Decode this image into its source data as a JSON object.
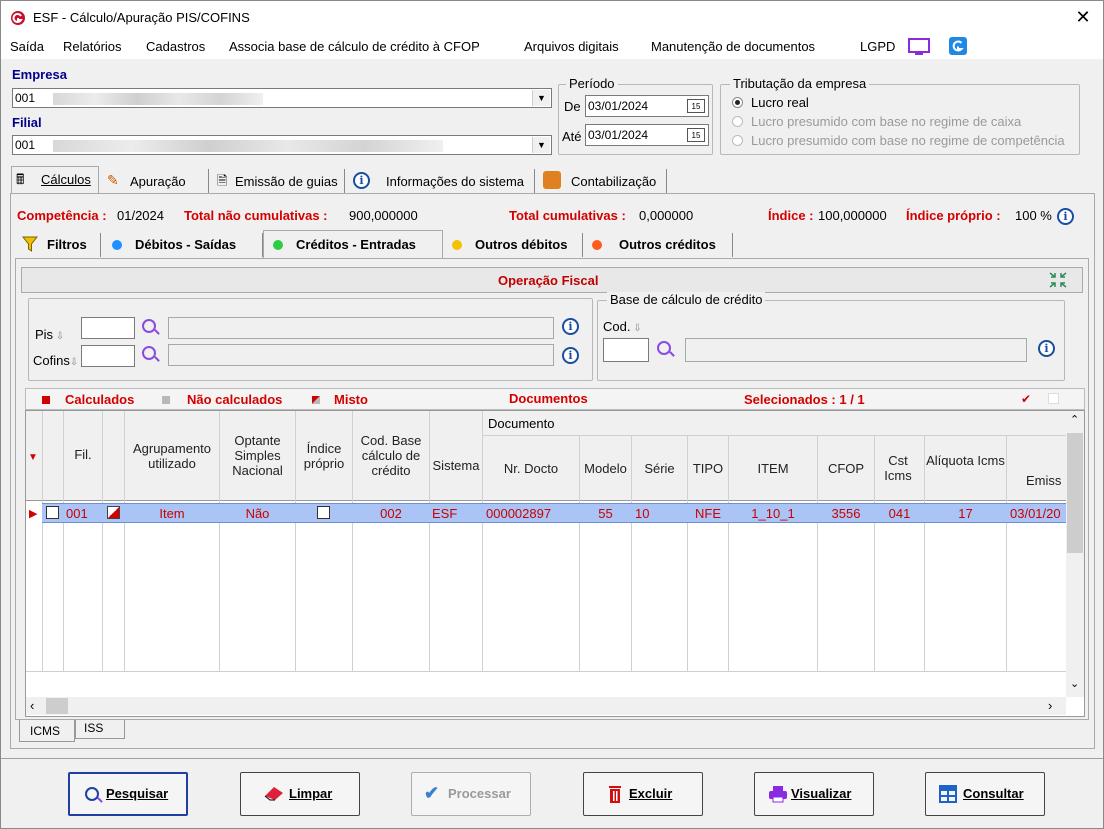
{
  "window": {
    "title": "ESF - Cálculo/Apuração PIS/COFINS",
    "close_glyph": "✕"
  },
  "menu": {
    "items": [
      "Saída",
      "Relatórios",
      "Cadastros",
      "Associa base de cálculo de crédito à CFOP",
      "Arquivos digitais",
      "Manutenção de documentos",
      "LGPD"
    ]
  },
  "empresa": {
    "label": "Empresa",
    "value": "001"
  },
  "filial": {
    "label": "Filial",
    "value": "001"
  },
  "periodo": {
    "legend": "Período",
    "de_label": "De",
    "de_value": "03/01/2024",
    "ate_label": "Até",
    "ate_value": "03/01/2024",
    "cal_glyph": "15"
  },
  "tributacao": {
    "legend": "Tributação da empresa",
    "options": [
      {
        "label": "Lucro real",
        "selected": true,
        "enabled": true
      },
      {
        "label": "Lucro presumido com base no regime de caixa",
        "selected": false,
        "enabled": false
      },
      {
        "label": "Lucro presumido com base no regime de competência",
        "selected": false,
        "enabled": false
      }
    ]
  },
  "main_tabs": {
    "calculos": "Cálculos",
    "apuracao": "Apuração",
    "emissao": "Emissão de guias",
    "informacoes": "Informações do sistema",
    "contabilizacao": "Contabilização"
  },
  "summary": {
    "competencia_label": "Competência :",
    "competencia_value": " 01/2024",
    "nao_cumulativas_label": "Total não cumulativas :",
    "nao_cumulativas_value": " 900,000000",
    "cumulativas_label": "Total cumulativas :",
    "cumulativas_value": " 0,000000",
    "indice_label": "Índice :",
    "indice_value": " 100,000000",
    "indice_proprio_label": "Índice próprio :",
    "indice_proprio_value": " 100 %"
  },
  "sub_tabs": {
    "filtros": "Filtros",
    "debitos": "Débitos - Saídas",
    "creditos": "Créditos - Entradas",
    "outros_debitos": "Outros débitos",
    "outros_creditos": "Outros créditos"
  },
  "operacao": {
    "title": "Operação Fiscal",
    "pis_label": "Pis",
    "cofins_label": "Cofins",
    "base_legend": "Base de cálculo de crédito",
    "cod_label": "Cod."
  },
  "grid": {
    "legend_calculados": "Calculados",
    "legend_nao_calculados": "Não calculados",
    "legend_misto": "Misto",
    "documentos": "Documentos",
    "selecionados": "Selecionados : 1 / 1",
    "documento_group": "Documento",
    "columns": {
      "fil": "Fil.",
      "agrupamento": "Agrupamento utilizado",
      "optante": "Optante Simples Nacional",
      "indice": "Índice próprio",
      "cod_base": "Cod. Base cálculo de crédito",
      "sistema": "Sistema",
      "nr_docto": "Nr. Docto",
      "modelo": "Modelo",
      "serie": "Série",
      "tipo": "TIPO",
      "item": "ITEM",
      "cfop": "CFOP",
      "cst": "Cst Icms",
      "aliquota": "Alíquota Icms",
      "emissao": "Emiss"
    },
    "row": {
      "fil": "001",
      "agrupamento": "Item",
      "optante": "Não",
      "cod_base": "002",
      "sistema": "ESF",
      "nr_docto": "000002897",
      "modelo": "55",
      "serie": "10",
      "tipo": "NFE",
      "item": "1_10_1",
      "cfop": "3556",
      "cst": "041",
      "aliquota": "17",
      "emissao": "03/01/20"
    }
  },
  "bottom_tabs": {
    "icms": "ICMS",
    "iss": "ISS"
  },
  "buttons": {
    "pesquisar": "Pesquisar",
    "limpar": "Limpar",
    "processar": "Processar",
    "excluir": "Excluir",
    "visualizar": "Visualizar",
    "consultar": "Consultar"
  },
  "colors": {
    "accent_red": "#d40000",
    "selection_blue": "#a9c4f5",
    "brand_blue": "#00008b"
  }
}
